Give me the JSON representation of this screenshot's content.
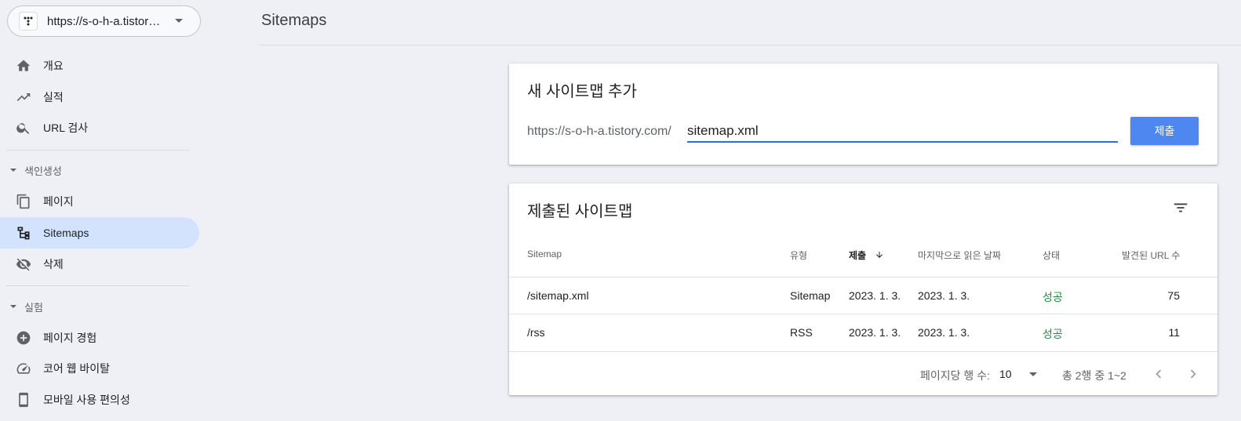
{
  "sidebar": {
    "property_url": "https://s-o-h-a.tistory.com/",
    "nav": [
      {
        "label": "개요",
        "icon": "home-icon"
      },
      {
        "label": "실적",
        "icon": "trending-up-icon"
      },
      {
        "label": "URL 검사",
        "icon": "search-icon"
      }
    ],
    "section_indexing": "색인생성",
    "indexing_items": [
      {
        "label": "페이지",
        "icon": "pages-icon"
      },
      {
        "label": "Sitemaps",
        "icon": "sitemap-icon",
        "active": true
      },
      {
        "label": "삭제",
        "icon": "visibility-off-icon"
      }
    ],
    "section_experience": "실험",
    "experience_items": [
      {
        "label": "페이지 경험",
        "icon": "add-circle-icon"
      },
      {
        "label": "코어 웹 바이탈",
        "icon": "speed-icon"
      },
      {
        "label": "모바일 사용 편의성",
        "icon": "smartphone-icon"
      }
    ]
  },
  "header": {
    "title": "Sitemaps"
  },
  "add_card": {
    "title": "새 사이트맵 추가",
    "prefix": "https://s-o-h-a.tistory.com/",
    "input_value": "sitemap.xml",
    "submit_label": "제출"
  },
  "submitted_card": {
    "title": "제출된 사이트맵",
    "columns": [
      "Sitemap",
      "유형",
      "제출",
      "마지막으로 읽은 날짜",
      "상태",
      "발견된 URL 수"
    ],
    "rows": [
      {
        "sitemap": "/sitemap.xml",
        "type": "Sitemap",
        "submitted": "2023. 1. 3.",
        "last_read": "2023. 1. 3.",
        "status": "성공",
        "urls": "75"
      },
      {
        "sitemap": "/rss",
        "type": "RSS",
        "submitted": "2023. 1. 3.",
        "last_read": "2023. 1. 3.",
        "status": "성공",
        "urls": "11"
      }
    ],
    "rows_per_page_label": "페이지당 행 수:",
    "rows_per_page_value": "10",
    "range_text": "총 2행 중 1~2"
  },
  "colors": {
    "accent": "#1a73e8",
    "active_nav": "#d3e3fd",
    "success": "#1e8e3e",
    "button": "#4e87f0"
  }
}
